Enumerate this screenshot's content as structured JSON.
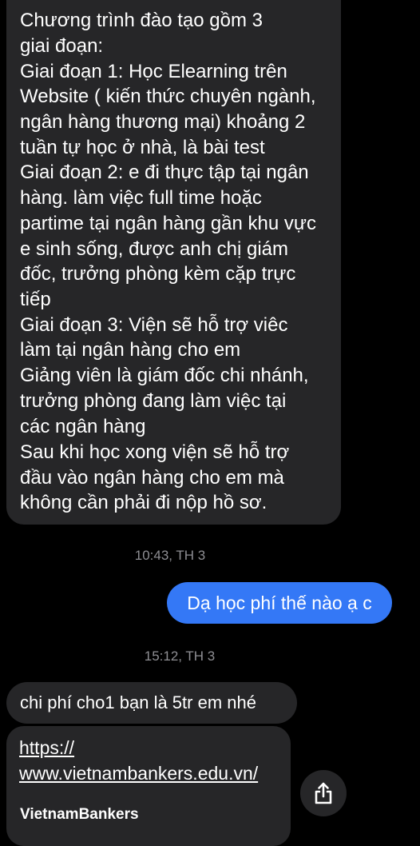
{
  "conversation": {
    "incoming_long_message": {
      "lines": [
        "Chương trình đào tạo gồm 3",
        "giai đoạn:",
        "Giai đoạn 1: Học Elearning trên",
        "Website ( kiến thức chuyên ngành,",
        "ngân hàng thương mại) khoảng 2",
        "tuần tự học ở nhà, là bài test",
        "Giai đoạn 2: e đi thực tập tại ngân",
        "hàng. làm việc full time hoặc",
        "partime tại ngân hàng gần khu vực",
        "e sinh sống, được anh chị giám",
        "đốc, trưởng phòng kèm cặp trực",
        "tiếp",
        "Giai đoạn 3: Viện sẽ hỗ trợ viêc",
        "làm tại ngân hàng cho em",
        "Giảng viên là giám đốc chi nhánh,",
        "trưởng phòng đang làm việc tại",
        "các ngân hàng",
        "Sau khi học xong viện sẽ hỗ trợ",
        "đầu vào ngân hàng cho em mà",
        "không cần phải đi nộp hồ sơ."
      ]
    },
    "timestamp_1": "10:43, TH 3",
    "outgoing_message": "Dạ học phí thế nào ạ c",
    "timestamp_2": "15:12, TH 3",
    "incoming_fee_message": "chi phí cho1 bạn là 5tr em nhé",
    "link_preview": {
      "url_line_1": "https://",
      "url_line_2": "www.vietnambankers.edu.vn/",
      "site_name": "VietnamBankers"
    },
    "share_icon": "share-icon"
  },
  "colors": {
    "background": "#000000",
    "incoming_bubble": "#262628",
    "outgoing_bubble": "#3478f6",
    "timestamp_text": "#8e8e93"
  }
}
